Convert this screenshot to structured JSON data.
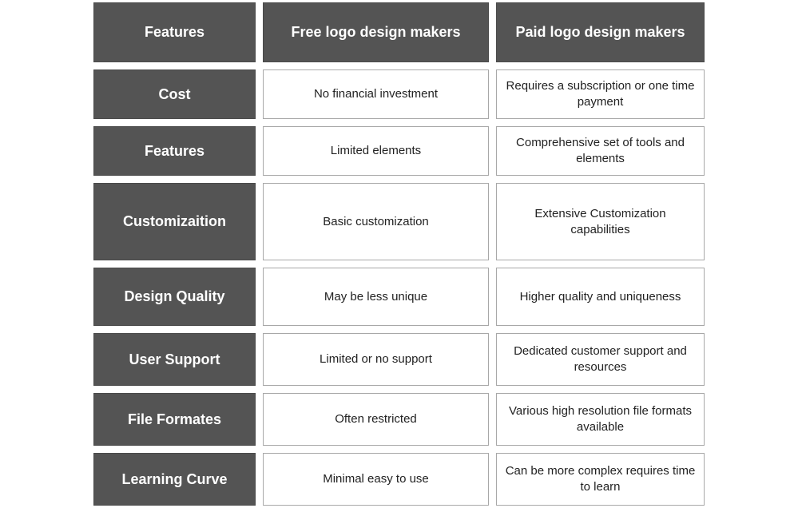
{
  "header": {
    "features": "Features",
    "free": "Free logo design makers",
    "paid": "Paid logo design makers"
  },
  "rows": [
    {
      "feature": "Cost",
      "free": "No financial investment",
      "paid": "Requires a subscription or one time payment"
    },
    {
      "feature": "Features",
      "free": "Limited elements",
      "paid": "Comprehensive set of tools and elements"
    },
    {
      "feature": "Customizaition",
      "free": "Basic customization",
      "paid": "Extensive Customization capabilities"
    },
    {
      "feature": "Design Quality",
      "free": "May be less unique",
      "paid": "Higher quality and uniqueness"
    },
    {
      "feature": "User Support",
      "free": "Limited or no support",
      "paid": "Dedicated customer support and resources"
    },
    {
      "feature": "File Formates",
      "free": "Often restricted",
      "paid": "Various high resolution file formats available"
    },
    {
      "feature": "Learning Curve",
      "free": "Minimal easy to use",
      "paid": "Can be more complex requires time to learn"
    }
  ],
  "colors": {
    "header_bg": "#545454",
    "header_text": "#ffffff",
    "cell_border": "#a8a8a8"
  }
}
